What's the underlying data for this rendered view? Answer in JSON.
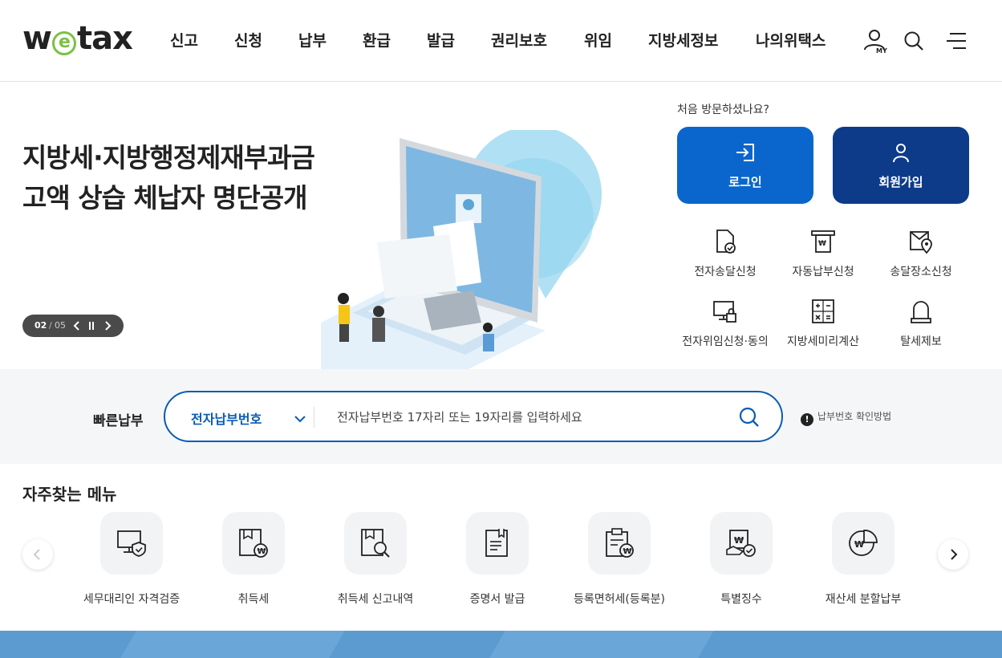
{
  "header": {
    "logo": {
      "pre": "w",
      "e": "e",
      "post": "tax"
    },
    "nav": [
      {
        "label": "신고"
      },
      {
        "label": "신청"
      },
      {
        "label": "납부"
      },
      {
        "label": "환급"
      },
      {
        "label": "발급"
      },
      {
        "label": "권리보호"
      },
      {
        "label": "위임"
      },
      {
        "label": "지방세정보"
      },
      {
        "label": "나의위택스"
      }
    ],
    "my_label": "MY"
  },
  "hero": {
    "title_line1": "지방세·지방행정제재부과금",
    "title_line2": "고액 상습 체납자 명단공개",
    "pager": {
      "current": "02",
      "separator": "/",
      "total": "05"
    }
  },
  "account": {
    "first_visit": "처음 방문하셨나요?",
    "login_label": "로그인",
    "join_label": "회원가입"
  },
  "quick_links": [
    {
      "label": "전자송달신청",
      "icon": "document-check-icon"
    },
    {
      "label": "자동납부신청",
      "icon": "auto-payment-icon"
    },
    {
      "label": "송달장소신청",
      "icon": "mail-location-icon"
    },
    {
      "label": "전자위임신청·동의",
      "icon": "monitor-lock-icon"
    },
    {
      "label": "지방세미리계산",
      "icon": "calculator-icon"
    },
    {
      "label": "탈세제보",
      "icon": "siren-icon"
    }
  ],
  "quick_pay": {
    "title": "빠른납부",
    "select_value": "전자납부번호",
    "placeholder": "전자납부번호 17자리 또는 19자리를 입력하세요",
    "help_text": "납부번호 확인방법",
    "help_mark": "!"
  },
  "frequent": {
    "title": "자주찾는 메뉴",
    "items": [
      {
        "label": "세무대리인 자격검증",
        "icon": "monitor-shield-icon"
      },
      {
        "label": "취득세",
        "icon": "document-won-icon"
      },
      {
        "label": "취득세 신고내역",
        "icon": "document-search-icon"
      },
      {
        "label": "증명서 발급",
        "icon": "certificate-icon"
      },
      {
        "label": "등록면허세(등록분)",
        "icon": "clipboard-won-icon"
      },
      {
        "label": "특별징수",
        "icon": "tax-check-icon"
      },
      {
        "label": "재산세 분할납부",
        "icon": "pie-won-icon"
      }
    ]
  },
  "colors": {
    "primary": "#0a66cc",
    "navy": "#0d3b8a",
    "accent_green": "#7bc143",
    "search_border": "#0a5bb5"
  }
}
